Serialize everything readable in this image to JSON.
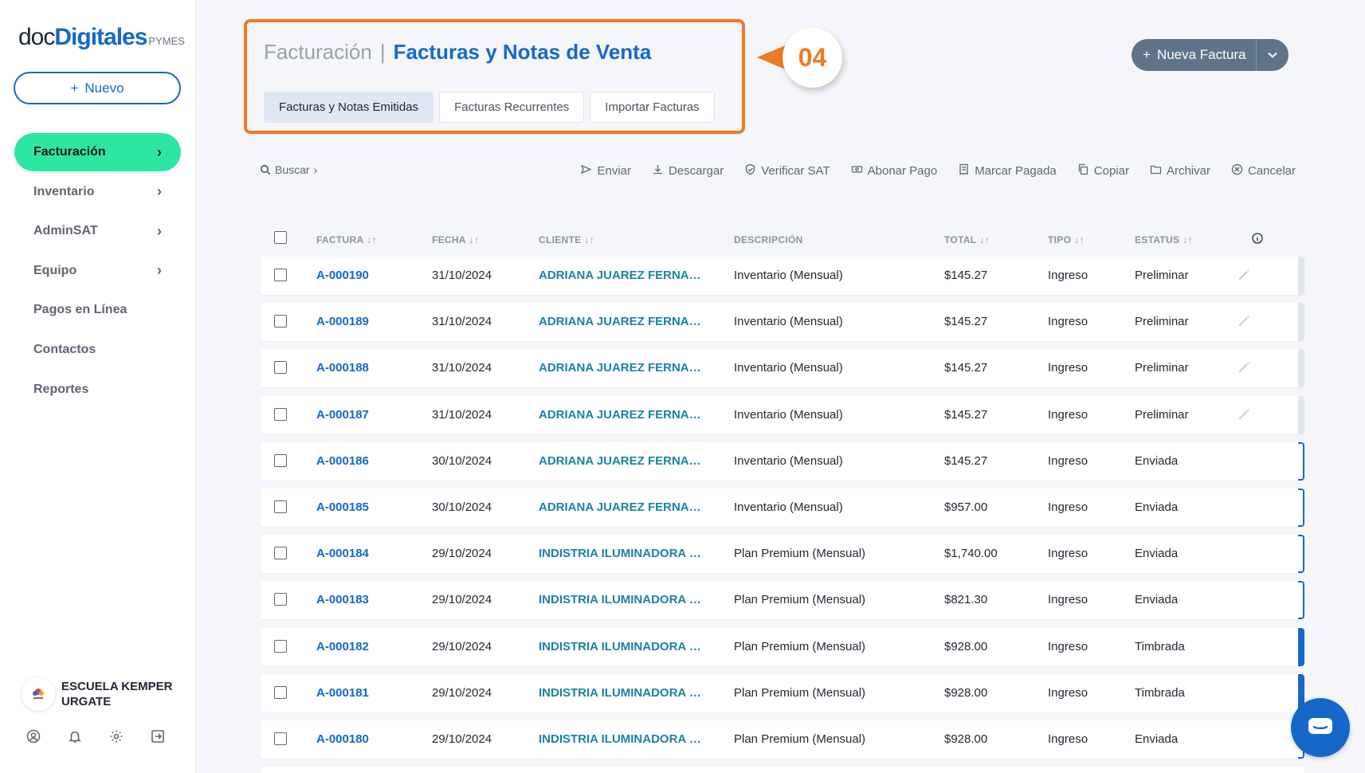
{
  "sidebar": {
    "logo": {
      "doc": "doc",
      "digitales": "Digitales",
      "pymes": "PYMES"
    },
    "nuevo_label": "Nuevo",
    "items": [
      {
        "label": "Facturación",
        "active": true,
        "chevron": true
      },
      {
        "label": "Inventario",
        "active": false,
        "chevron": true
      },
      {
        "label": "AdminSAT",
        "active": false,
        "chevron": true
      },
      {
        "label": "Equipo",
        "active": false,
        "chevron": true
      },
      {
        "label": "Pagos en Línea",
        "active": false,
        "chevron": false
      },
      {
        "label": "Contactos",
        "active": false,
        "chevron": false
      },
      {
        "label": "Reportes",
        "active": false,
        "chevron": false
      }
    ],
    "org_name": "ESCUELA KEMPER URGATE",
    "footer_icons": [
      "user-circle-icon",
      "bell-icon",
      "gear-icon",
      "logout-icon"
    ]
  },
  "header": {
    "section": "Facturación",
    "separator": "|",
    "title": "Facturas y Notas de Venta",
    "tabs": [
      {
        "label": "Facturas y Notas Emitidas",
        "active": true
      },
      {
        "label": "Facturas Recurrentes",
        "active": false
      },
      {
        "label": "Importar Facturas",
        "active": false
      }
    ],
    "callout_number": "04",
    "new_button_label": "Nueva Factura"
  },
  "toolbar": {
    "search_label": "Buscar",
    "actions": [
      {
        "label": "Enviar",
        "icon": "send-icon"
      },
      {
        "label": "Descargar",
        "icon": "download-icon"
      },
      {
        "label": "Verificar SAT",
        "icon": "shield-check-icon"
      },
      {
        "label": "Abonar Pago",
        "icon": "cash-icon"
      },
      {
        "label": "Marcar Pagada",
        "icon": "receipt-icon"
      },
      {
        "label": "Copiar",
        "icon": "copy-icon"
      },
      {
        "label": "Archivar",
        "icon": "folder-icon"
      },
      {
        "label": "Cancelar",
        "icon": "cancel-circle-icon"
      }
    ]
  },
  "table": {
    "columns": {
      "factura": "FACTURA",
      "fecha": "FECHA",
      "cliente": "CLIENTE",
      "descripcion": "DESCRIPCIÓN",
      "total": "TOTAL",
      "tipo": "TIPO",
      "estatus": "ESTATUS"
    },
    "rows": [
      {
        "factura": "A-000190",
        "fecha": "31/10/2024",
        "cliente": "ADRIANA JUAREZ FERNAND...",
        "descripcion": "Inventario (Mensual)",
        "total": "$145.27",
        "tipo": "Ingreso",
        "estatus": "Preliminar",
        "editable": true,
        "stripe": "gray"
      },
      {
        "factura": "A-000189",
        "fecha": "31/10/2024",
        "cliente": "ADRIANA JUAREZ FERNAND...",
        "descripcion": "Inventario (Mensual)",
        "total": "$145.27",
        "tipo": "Ingreso",
        "estatus": "Preliminar",
        "editable": true,
        "stripe": "gray"
      },
      {
        "factura": "A-000188",
        "fecha": "31/10/2024",
        "cliente": "ADRIANA JUAREZ FERNAND...",
        "descripcion": "Inventario (Mensual)",
        "total": "$145.27",
        "tipo": "Ingreso",
        "estatus": "Preliminar",
        "editable": true,
        "stripe": "gray"
      },
      {
        "factura": "A-000187",
        "fecha": "31/10/2024",
        "cliente": "ADRIANA JUAREZ FERNAND...",
        "descripcion": "Inventario (Mensual)",
        "total": "$145.27",
        "tipo": "Ingreso",
        "estatus": "Preliminar",
        "editable": true,
        "stripe": "gray"
      },
      {
        "factura": "A-000186",
        "fecha": "30/10/2024",
        "cliente": "ADRIANA JUAREZ FERNAND...",
        "descripcion": "Inventario (Mensual)",
        "total": "$145.27",
        "tipo": "Ingreso",
        "estatus": "Enviada",
        "editable": false,
        "stripe": "outline"
      },
      {
        "factura": "A-000185",
        "fecha": "30/10/2024",
        "cliente": "ADRIANA JUAREZ FERNAND...",
        "descripcion": "Inventario (Mensual)",
        "total": "$957.00",
        "tipo": "Ingreso",
        "estatus": "Enviada",
        "editable": false,
        "stripe": "outline"
      },
      {
        "factura": "A-000184",
        "fecha": "29/10/2024",
        "cliente": "INDISTRIA ILUMINADORA DE...",
        "descripcion": "Plan Premium (Mensual)",
        "total": "$1,740.00",
        "tipo": "Ingreso",
        "estatus": "Enviada",
        "editable": false,
        "stripe": "outline"
      },
      {
        "factura": "A-000183",
        "fecha": "29/10/2024",
        "cliente": "INDISTRIA ILUMINADORA DE...",
        "descripcion": "Plan Premium (Mensual)",
        "total": "$821.30",
        "tipo": "Ingreso",
        "estatus": "Enviada",
        "editable": false,
        "stripe": "outline"
      },
      {
        "factura": "A-000182",
        "fecha": "29/10/2024",
        "cliente": "INDISTRIA ILUMINADORA DE...",
        "descripcion": "Plan Premium (Mensual)",
        "total": "$928.00",
        "tipo": "Ingreso",
        "estatus": "Timbrada",
        "editable": false,
        "stripe": "solid"
      },
      {
        "factura": "A-000181",
        "fecha": "29/10/2024",
        "cliente": "INDISTRIA ILUMINADORA DE...",
        "descripcion": "Plan Premium (Mensual)",
        "total": "$928.00",
        "tipo": "Ingreso",
        "estatus": "Timbrada",
        "editable": false,
        "stripe": "solid"
      },
      {
        "factura": "A-000180",
        "fecha": "29/10/2024",
        "cliente": "INDISTRIA ILUMINADORA DE...",
        "descripcion": "Plan Premium (Mensual)",
        "total": "$928.00",
        "tipo": "Ingreso",
        "estatus": "Enviada",
        "editable": false,
        "stripe": "outline"
      }
    ]
  },
  "colors": {
    "brand_blue": "#1668c8",
    "accent_green": "#2ee6a3",
    "callout_orange": "#ee7a22",
    "client_teal": "#1a82a9"
  }
}
